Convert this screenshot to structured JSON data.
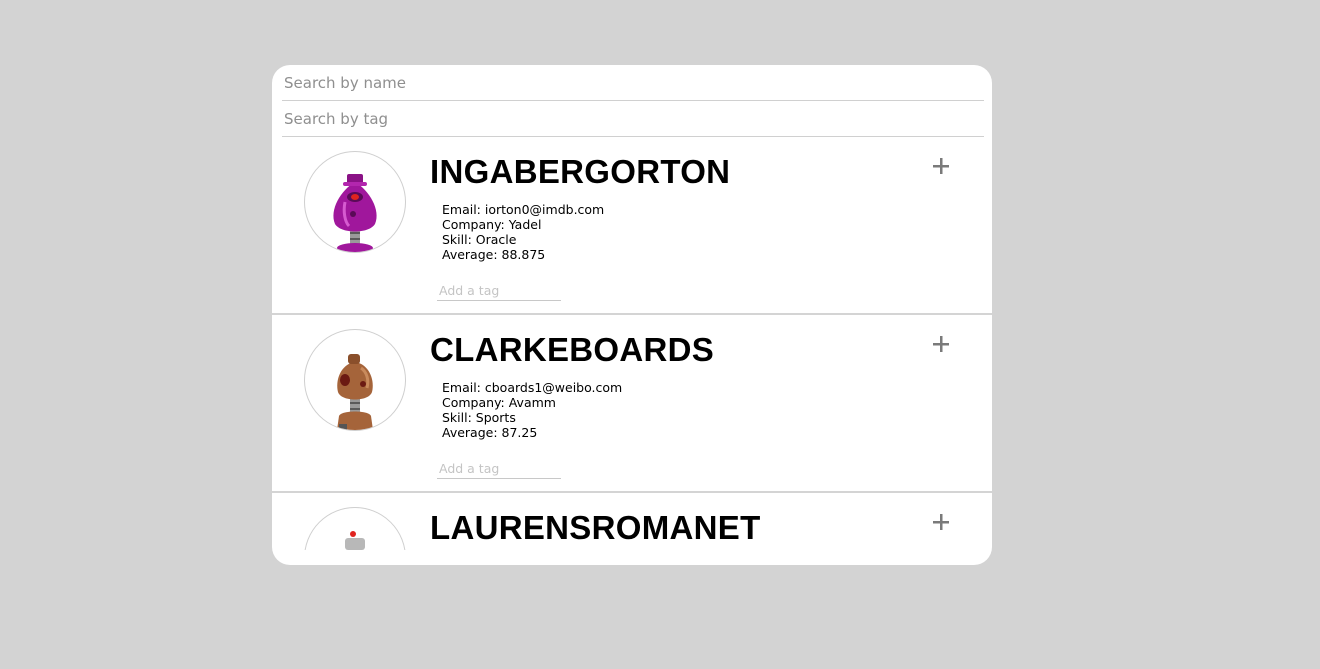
{
  "search": {
    "name_placeholder": "Search by name",
    "tag_placeholder": "Search by tag"
  },
  "students": [
    {
      "name": "INGABERGORTON",
      "email_label": "Email: iorton0@imdb.com",
      "company_label": "Company: Yadel",
      "skill_label": "Skill: Oracle",
      "average_label": "Average: 88.875",
      "tag_placeholder": "Add a tag",
      "avatar_icon": "robot-avatar-icon",
      "avatar_color": "#a0179c"
    },
    {
      "name": "CLARKEBOARDS",
      "email_label": "Email: cboards1@weibo.com",
      "company_label": "Company: Avamm",
      "skill_label": "Skill: Sports",
      "average_label": "Average: 87.25",
      "tag_placeholder": "Add a tag",
      "avatar_icon": "robot-avatar-icon",
      "avatar_color": "#a5643a"
    },
    {
      "name": "LAURENSROMANET",
      "avatar_icon": "robot-avatar-icon",
      "avatar_color": "#9a9a9a"
    }
  ],
  "icons": {
    "expand": "plus-icon"
  },
  "colors": {
    "background": "#d3d3d3",
    "card": "#ffffff",
    "divider": "#d4d4d4",
    "plus": "#7a7a7a"
  }
}
